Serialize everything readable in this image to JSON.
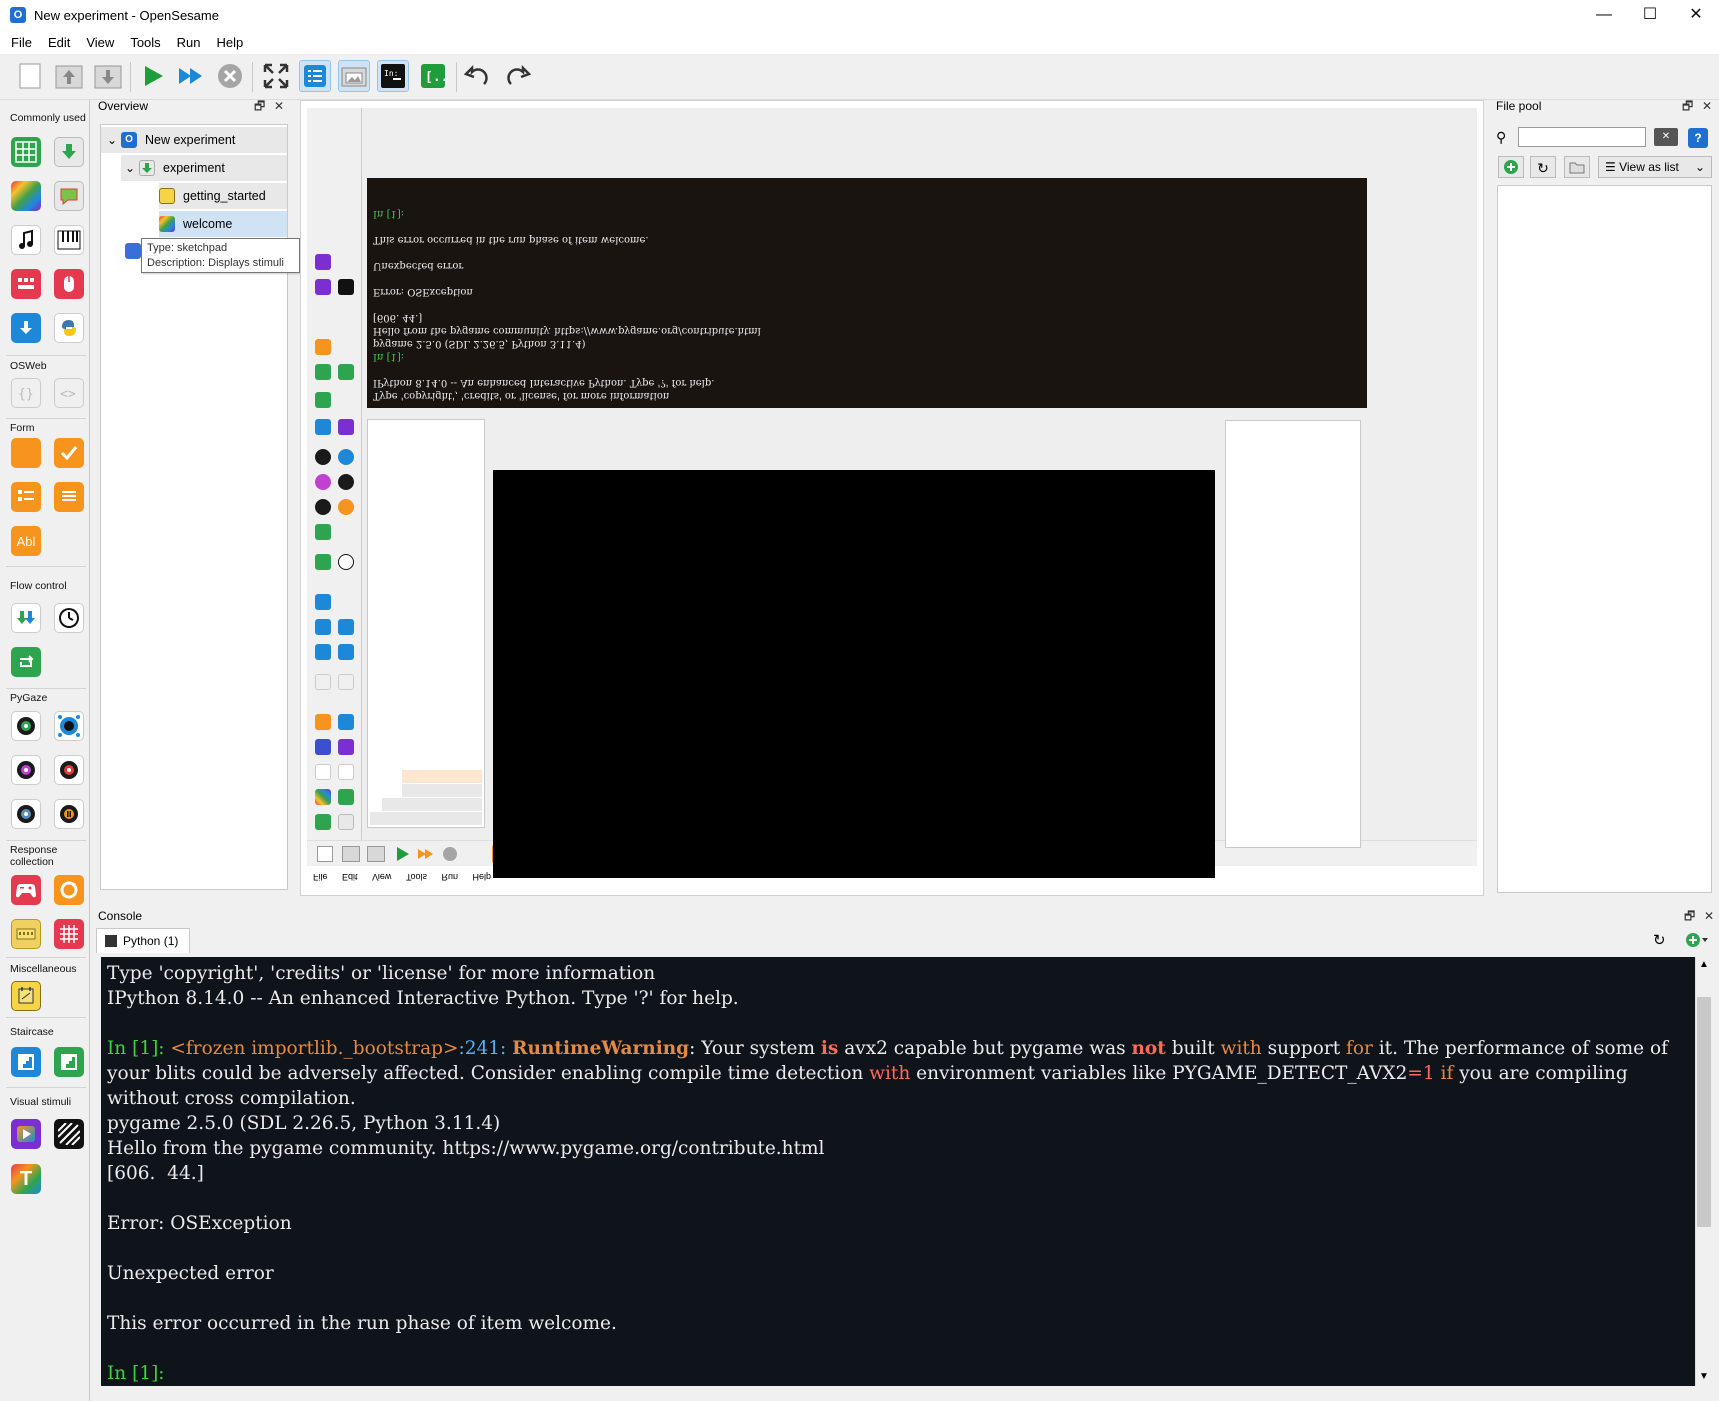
{
  "window": {
    "title": "New experiment - OpenSesame",
    "app_icon": "opensesame-icon",
    "minimize": "—",
    "maximize": "☐",
    "close": "✕"
  },
  "menu": [
    "File",
    "Edit",
    "View",
    "Tools",
    "Run",
    "Help"
  ],
  "toolbar": {
    "buttons": [
      "new-icon",
      "open-icon",
      "save-icon",
      "run-icon",
      "quick-run-icon",
      "abort-icon",
      "fullscreen-icon",
      "overview-icon",
      "file-pool-icon",
      "console-icon",
      "variables-icon",
      "undo-icon",
      "redo-icon"
    ]
  },
  "item_toolbar": {
    "categories": {
      "commonly_used": "Commonly used",
      "osweb": "OSWeb",
      "form": "Form",
      "flow_control": "Flow control",
      "pygaze": "PyGaze",
      "response_collection": "Response collection",
      "miscellaneous": "Miscellaneous",
      "staircase": "Staircase",
      "visual_stimuli": "Visual stimuli"
    },
    "form_text_input_glyph": "Abl",
    "text_display_glyph": "T"
  },
  "overview": {
    "title": "Overview",
    "float_glyph": "🗗",
    "close_glyph": "✕",
    "tree": [
      {
        "label": "New experiment",
        "expand": "⌄"
      },
      {
        "label": "experiment",
        "expand": "⌄"
      },
      {
        "label": "getting_started"
      },
      {
        "label": "welcome"
      }
    ],
    "tooltip": {
      "type": "Type: sketchpad",
      "description": "Description: Displays stimuli"
    }
  },
  "file_pool": {
    "title": "File pool",
    "search_value": "",
    "view_mode": "View as list"
  },
  "console": {
    "title": "Console",
    "tab": "Python (1)",
    "prompt": "In [1]:",
    "lines": {
      "l1": "Type 'copyright', 'credits' or 'license' for more information",
      "l2": "IPython 8.14.0 -- An enhanced Interactive Python. Type '?' for help.",
      "l3_prompt": "In [1]:",
      "l3_a": " <frozen importlib._bootstrap>",
      "l3_b": ":241: ",
      "l3_c": "RuntimeWarning",
      "l3_d": ": Your system ",
      "l3_e": "is",
      "l3_f": " avx2 capable but pygame was ",
      "l3_g": "not",
      "l3_h": " built ",
      "l3_i": "with",
      "l3_j": " support ",
      "l3_k": "for",
      "l3_l": " it. The performance of some of your blits could be adversely affected. Consider enabling compile time detection ",
      "l3_m": "with",
      "l3_n": " environment variables like PYGAME_DETECT_AVX2",
      "l3_o": "=1",
      "l3_p": " if",
      "l3_q": " you are compiling without cross compilation.",
      "l4": "pygame 2.5.0 (SDL 2.26.5, Python 3.11.4)",
      "l5": "Hello from the pygame community. https://www.pygame.org/contribute.html",
      "l6": "[606.  44.]",
      "l7": "Error: OSException",
      "l8": "Unexpected error",
      "l9": "This error occurred in the run phase of item welcome."
    }
  },
  "colors": {
    "console_bg": "#0f141b",
    "prompt_green": "#3fd13f",
    "warning_orange": "#e58a42",
    "keyword_red": "#ff6a5a",
    "accent_blue": "#1e6fd0"
  }
}
